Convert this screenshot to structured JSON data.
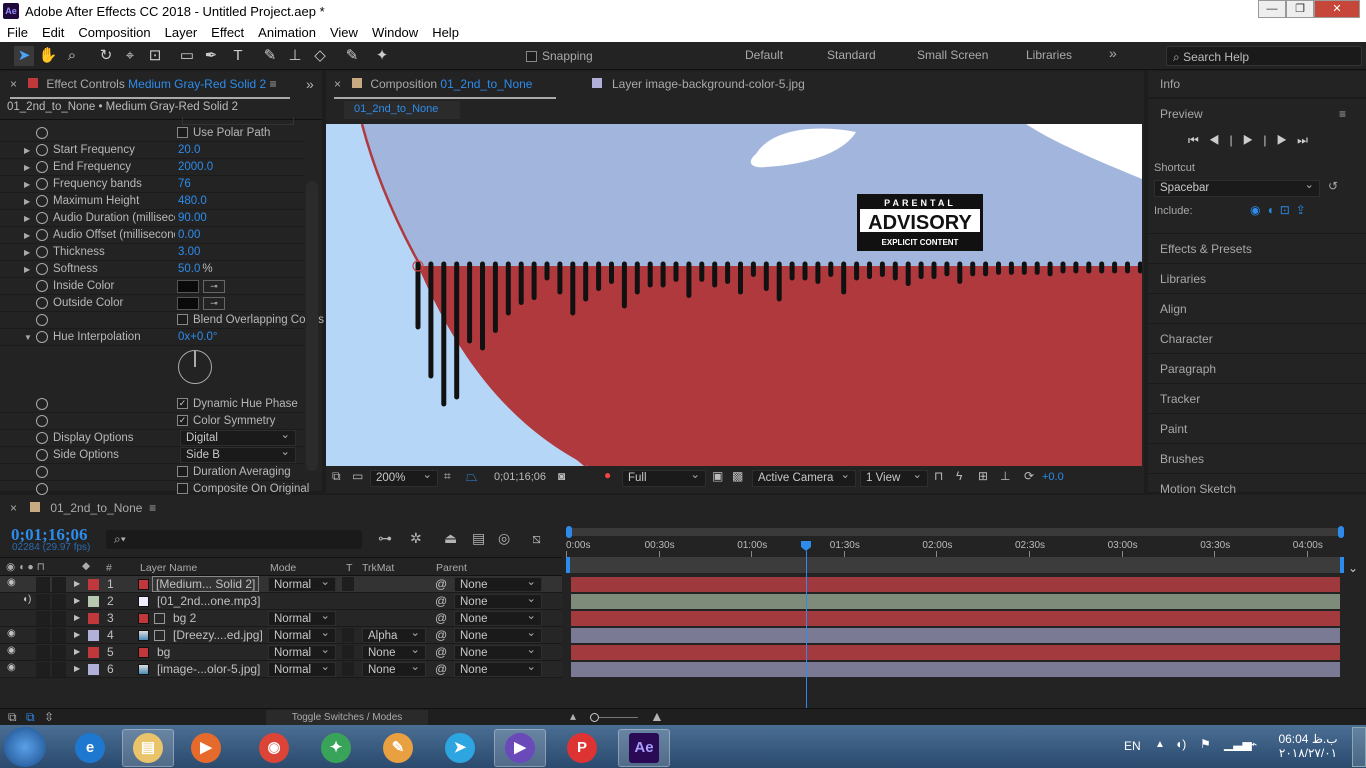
{
  "window": {
    "title": "Adobe After Effects CC 2018 - Untitled Project.aep *",
    "app_icon": "Ae"
  },
  "menu": [
    "File",
    "Edit",
    "Composition",
    "Layer",
    "Effect",
    "Animation",
    "View",
    "Window",
    "Help"
  ],
  "toolbar": {
    "snapping": "Snapping",
    "workspaces": [
      "Default",
      "Standard",
      "Small Screen",
      "Libraries"
    ],
    "search_placeholder": "Search Help"
  },
  "effect_controls": {
    "tab_prefix": "Effect Controls",
    "layer": "Medium Gray-Red Solid 2",
    "breadcrumb": "01_2nd_to_None • Medium Gray-Red Solid 2",
    "props": [
      {
        "label": "",
        "check": "Use Polar Path",
        "checked": false
      },
      {
        "label": "Start Frequency",
        "value": "20.0",
        "tri": "right"
      },
      {
        "label": "End Frequency",
        "value": "2000.0",
        "tri": "right"
      },
      {
        "label": "Frequency bands",
        "value": "76",
        "tri": "right"
      },
      {
        "label": "Maximum Height",
        "value": "480.0",
        "tri": "right"
      },
      {
        "label": "Audio Duration (milliseconds)",
        "value": "90.00",
        "tri": "right"
      },
      {
        "label": "Audio Offset (milliseconds)",
        "value": "0.00",
        "tri": "right"
      },
      {
        "label": "Thickness",
        "value": "3.00",
        "tri": "right"
      },
      {
        "label": "Softness",
        "value": "50.0",
        "unit": "%",
        "tri": "right"
      },
      {
        "label": "Inside Color",
        "color": "#0a0a0a"
      },
      {
        "label": "Outside Color",
        "color": "#0a0a0a"
      },
      {
        "label": "",
        "check": "Blend Overlapping Colors",
        "checked": false
      },
      {
        "label": "Hue Interpolation",
        "value": "0x+0.0°",
        "tri": "down"
      }
    ],
    "props2": [
      {
        "label": "",
        "check": "Dynamic Hue Phase",
        "checked": true
      },
      {
        "label": "",
        "check": "Color Symmetry",
        "checked": true
      },
      {
        "label": "Display Options",
        "select": "Digital"
      },
      {
        "label": "Side Options",
        "select": "Side B"
      },
      {
        "label": "",
        "check": "Duration Averaging",
        "checked": false
      },
      {
        "label": "",
        "check": "Composite On Original",
        "checked": false
      }
    ]
  },
  "composition": {
    "tab_prefix": "Composition",
    "name": "01_2nd_to_None",
    "layer_tab": "Layer  image-background-color-5.jpg",
    "subtab": "01_2nd_to_None",
    "advisory": [
      "PARENTAL",
      "ADVISORY",
      "EXPLICIT CONTENT"
    ],
    "viewer_bar": {
      "zoom": "200%",
      "timecode": "0;01;16;06",
      "resolution": "Full",
      "camera": "Active Camera",
      "views": "1 View",
      "exposure": "+0.0"
    }
  },
  "right_panel": {
    "items": [
      "Info",
      "Preview",
      "Effects & Presets",
      "Libraries",
      "Align",
      "Character",
      "Paragraph",
      "Tracker",
      "Paint",
      "Brushes",
      "Motion Sketch"
    ],
    "shortcut_label": "Shortcut",
    "shortcut": "Spacebar",
    "include_label": "Include:"
  },
  "timeline": {
    "tab": "01_2nd_to_None",
    "timecode": "0;01;16;06",
    "frames": "02284 (29.97 fps)",
    "columns": {
      "num": "#",
      "name": "Layer Name",
      "mode": "Mode",
      "t": "T",
      "trkmat": "TrkMat",
      "parent": "Parent"
    },
    "ruler": [
      "0:00s",
      "00:30s",
      "01:00s",
      "01:30s",
      "02:00s",
      "02:30s",
      "03:00s",
      "03:30s",
      "04:00s"
    ],
    "playhead_time": "0;01;16;06",
    "layers": [
      {
        "num": "1",
        "name": "[Medium... Solid 2]",
        "mode": "Normal",
        "trkmat": "",
        "parent": "None",
        "label": "#c0383c",
        "bar": "#9e3a3e",
        "eye": true,
        "audio": false,
        "icon": "solid"
      },
      {
        "num": "2",
        "name": "[01_2nd...one.mp3]",
        "mode": "",
        "trkmat": "",
        "parent": "None",
        "label": "#b6c8b0",
        "bar": "#7e8a7a",
        "eye": false,
        "audio": true,
        "icon": "audio"
      },
      {
        "num": "3",
        "name": "bg 2",
        "mode": "Normal",
        "trkmat": "",
        "parent": "None",
        "label": "#c0383c",
        "bar": "#a33a3e",
        "eye": false,
        "audio": false,
        "icon": "solid"
      },
      {
        "num": "4",
        "name": "[Dreezy....ed.jpg]",
        "mode": "Normal",
        "trkmat": "Alpha",
        "parent": "None",
        "label": "#b0b0d8",
        "bar": "#7a7a95",
        "eye": true,
        "audio": false,
        "icon": "image"
      },
      {
        "num": "5",
        "name": "bg",
        "mode": "Normal",
        "trkmat": "None",
        "parent": "None",
        "label": "#c0383c",
        "bar": "#a33a3e",
        "eye": true,
        "audio": false,
        "icon": "solid"
      },
      {
        "num": "6",
        "name": "[image-...olor-5.jpg]",
        "mode": "Normal",
        "trkmat": "None",
        "parent": "None",
        "label": "#b0b0d8",
        "bar": "#7a7a95",
        "eye": true,
        "audio": false,
        "icon": "image"
      }
    ],
    "toggle": "Toggle Switches / Modes"
  },
  "taskbar": {
    "lang": "EN",
    "time": "06:04 ب.ظ",
    "date": "۲۰۱۸/۲۷/۰۱",
    "apps": [
      "Internet Explorer",
      "File Explorer",
      "Media Player",
      "Chrome",
      "Internet Download Manager",
      "Paint",
      "Telegram",
      "Visual Studio",
      "Pitch",
      "After Effects"
    ]
  },
  "colors": {
    "accent": "#2d8ceb",
    "comp_red": "#b0393d",
    "comp_sky": "#a2b5dd",
    "comp_light": "#b6d6f8"
  }
}
